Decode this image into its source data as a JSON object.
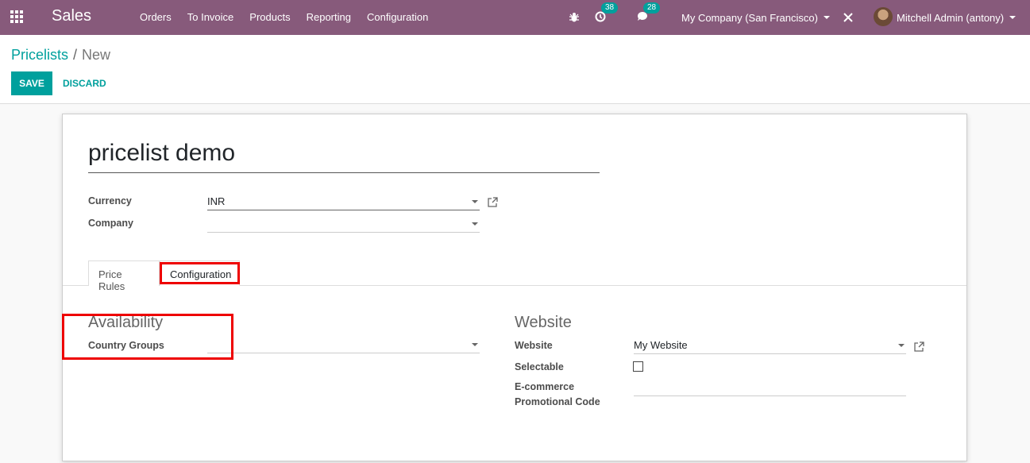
{
  "navbar": {
    "app_name": "Sales",
    "menu": [
      "Orders",
      "To Invoice",
      "Products",
      "Reporting",
      "Configuration"
    ],
    "activity_count": "38",
    "messages_count": "28",
    "company": "My Company (San Francisco)",
    "user": "Mitchell Admin (antony)",
    "color": "#875a7b"
  },
  "breadcrumb": {
    "parent": "Pricelists",
    "separator": "/",
    "current": "New"
  },
  "buttons": {
    "save": "Save",
    "discard": "Discard"
  },
  "form": {
    "name": "pricelist demo",
    "currency_label": "Currency",
    "currency_value": "INR",
    "company_label": "Company",
    "company_value": ""
  },
  "tabs": [
    {
      "label": "Price Rules",
      "active": false
    },
    {
      "label": "Configuration",
      "active": true
    }
  ],
  "availability": {
    "title": "Availability",
    "country_groups_label": "Country Groups",
    "country_groups_value": ""
  },
  "website": {
    "title": "Website",
    "website_label": "Website",
    "website_value": "My Website",
    "selectable_label": "Selectable",
    "selectable_checked": false,
    "promo_label_line1": "E-commerce",
    "promo_label_line2": "Promotional Code",
    "promo_value": ""
  },
  "colors": {
    "accent": "#00a09d",
    "highlight": "#e00000"
  }
}
